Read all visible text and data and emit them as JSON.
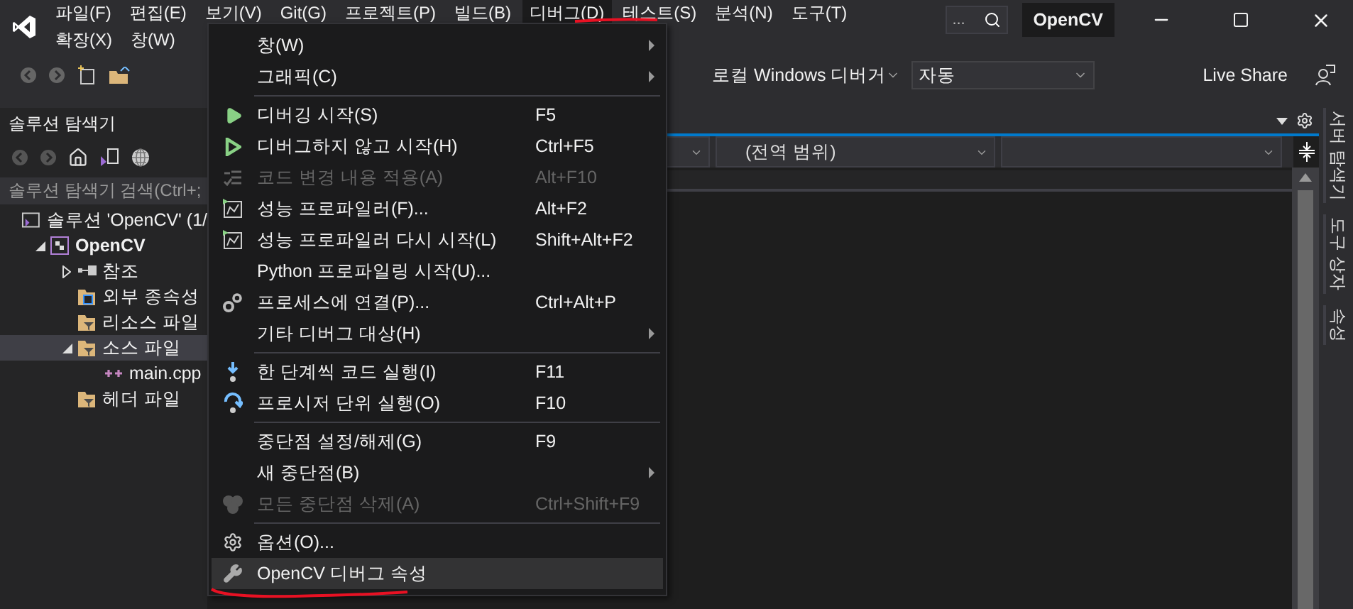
{
  "menubar": {
    "rows": [
      [
        {
          "label": "파일(F)",
          "selected": false
        },
        {
          "label": "편집(E)",
          "selected": false
        },
        {
          "label": "보기(V)",
          "selected": false
        },
        {
          "label": "Git(G)",
          "selected": false
        },
        {
          "label": "프로젝트(P)",
          "selected": false
        },
        {
          "label": "빌드(B)",
          "selected": false
        },
        {
          "label": "디버그(D)",
          "selected": true
        },
        {
          "label": "테스트(S)",
          "selected": false
        },
        {
          "label": "분석(N)",
          "selected": false
        },
        {
          "label": "도구(T)",
          "selected": false
        }
      ],
      [
        {
          "label": "확장(X)",
          "selected": false
        },
        {
          "label": "창(W)",
          "selected": false
        }
      ]
    ]
  },
  "search": {
    "placeholder": "..."
  },
  "solution_name": "OpenCV",
  "toolbar": {
    "debugger": "로컬 Windows 디버거",
    "configuration": "자동",
    "live_share": "Live Share"
  },
  "solution_explorer": {
    "title": "솔루션 탐색기",
    "search": {
      "placeholder": "솔루션 탐색기 검색(Ctrl+;"
    },
    "tree": [
      {
        "label": "솔루션 'OpenCV' (1/",
        "kind": "solution",
        "selected": false,
        "children": [
          {
            "label": "OpenCV",
            "kind": "project",
            "bold": true,
            "expanded": true,
            "selected": false,
            "children": [
              {
                "label": "참조",
                "kind": "references",
                "expanded": false,
                "selected": false
              },
              {
                "label": "외부 종속성",
                "kind": "external",
                "selected": false
              },
              {
                "label": "리소스 파일",
                "kind": "filter",
                "selected": false
              },
              {
                "label": "소스 파일",
                "kind": "filter",
                "expanded": true,
                "selected": true,
                "children": [
                  {
                    "label": "main.cpp",
                    "kind": "cpp",
                    "selected": false
                  }
                ]
              },
              {
                "label": "헤더 파일",
                "kind": "filter",
                "selected": false
              }
            ]
          }
        ]
      }
    ]
  },
  "editor": {
    "scope": "(전역 범위)"
  },
  "side_tabs": [
    "서버 탐색기",
    "도구 상자",
    "속성"
  ],
  "debug_menu": {
    "items": [
      {
        "kind": "plain",
        "label": "창(W)",
        "submenu": true,
        "disabled": false,
        "selected": false
      },
      {
        "kind": "plain",
        "label": "그래픽(C)",
        "submenu": true,
        "disabled": false,
        "selected": false
      },
      {
        "kind": "separator"
      },
      {
        "kind": "play",
        "label": "디버깅 시작(S)",
        "shortcut": "F5",
        "disabled": false,
        "selected": false
      },
      {
        "kind": "play-outline",
        "label": "디버그하지 않고 시작(H)",
        "shortcut": "Ctrl+F5",
        "disabled": false,
        "selected": false
      },
      {
        "kind": "code-changes",
        "label": "코드 변경 내용 적용(A)",
        "shortcut": "Alt+F10",
        "disabled": true,
        "selected": false
      },
      {
        "kind": "profiler",
        "label": "성능 프로파일러(F)...",
        "shortcut": "Alt+F2",
        "disabled": false,
        "selected": false
      },
      {
        "kind": "profiler",
        "label": "성능 프로파일러 다시 시작(L)",
        "shortcut": "Shift+Alt+F2",
        "disabled": false,
        "selected": false
      },
      {
        "kind": "plain",
        "label": "Python 프로파일링 시작(U)...",
        "disabled": false,
        "selected": false
      },
      {
        "kind": "gears",
        "label": "프로세스에 연결(P)...",
        "shortcut": "Ctrl+Alt+P",
        "disabled": false,
        "selected": false
      },
      {
        "kind": "plain",
        "label": "기타 디버그 대상(H)",
        "submenu": true,
        "disabled": false,
        "selected": false
      },
      {
        "kind": "separator"
      },
      {
        "kind": "step-into",
        "label": "한 단계씩 코드 실행(I)",
        "shortcut": "F11",
        "disabled": false,
        "selected": false
      },
      {
        "kind": "step-over",
        "label": "프로시저 단위 실행(O)",
        "shortcut": "F10",
        "disabled": false,
        "selected": false
      },
      {
        "kind": "separator"
      },
      {
        "kind": "plain",
        "label": "중단점 설정/해제(G)",
        "shortcut": "F9",
        "disabled": false,
        "selected": false
      },
      {
        "kind": "plain",
        "label": "새 중단점(B)",
        "submenu": true,
        "disabled": false,
        "selected": false
      },
      {
        "kind": "breakpoints",
        "label": "모든 중단점 삭제(A)",
        "shortcut": "Ctrl+Shift+F9",
        "disabled": true,
        "selected": false
      },
      {
        "kind": "separator"
      },
      {
        "kind": "gear",
        "label": "옵션(O)...",
        "disabled": false,
        "selected": false
      },
      {
        "kind": "wrench",
        "label": "OpenCV 디버그 속성",
        "disabled": false,
        "selected": true
      }
    ]
  }
}
